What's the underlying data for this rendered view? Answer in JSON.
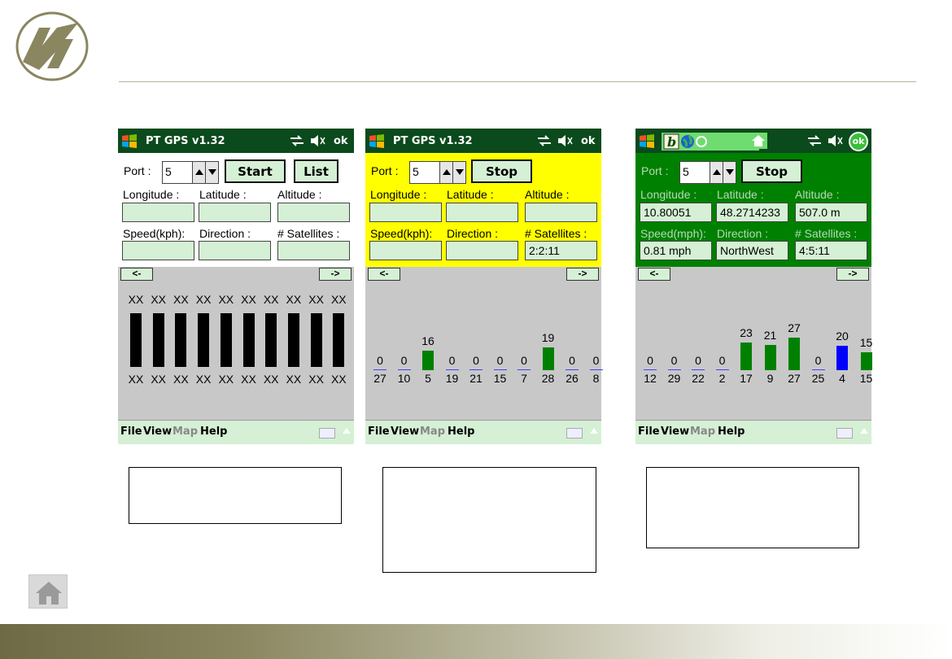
{
  "colors": {
    "accent_green": "#008000",
    "title_green": "#0b4a1c",
    "field_green": "#d5f0d5",
    "yellow": "#ffff00",
    "blue_bar": "#0000ff"
  },
  "logo": {
    "icon": "company-logo-icon"
  },
  "home": {
    "icon": "home-icon"
  },
  "screens": [
    {
      "title": "PT GPS v1.32",
      "ok": "ok",
      "port_label": "Port :",
      "port_value": "5",
      "btn1": "Start",
      "btn2": "List",
      "lon_label": "Longitude :",
      "lat_label": "Latitude :",
      "alt_label": "Altitude :",
      "speed_label": "Speed(kph):",
      "dir_label": "Direction :",
      "sat_label": "# Satellites :",
      "lon": "",
      "lat": "",
      "alt": "",
      "speed": "",
      "dir": "",
      "sat": "",
      "nav_left": "<-",
      "nav_right": "->",
      "menu": {
        "file": "File",
        "view": "View",
        "map": "Map",
        "help": "Help"
      },
      "bars_top": [
        "XX",
        "XX",
        "XX",
        "XX",
        "XX",
        "XX",
        "XX",
        "XX",
        "XX",
        "XX"
      ],
      "bars_bottom": [
        "XX",
        "XX",
        "XX",
        "XX",
        "XX",
        "XX",
        "XX",
        "XX",
        "XX",
        "XX"
      ]
    },
    {
      "title": "PT GPS v1.32",
      "ok": "ok",
      "port_label": "Port :",
      "port_value": "5",
      "btn1": "Stop",
      "lon_label": "Longitude :",
      "lat_label": "Latitude :",
      "alt_label": "Altitude :",
      "speed_label": "Speed(kph):",
      "dir_label": "Direction :",
      "sat_label": "# Satellites :",
      "lon": "",
      "lat": "",
      "alt": "",
      "speed": "",
      "dir": "",
      "sat": "2:2:11",
      "nav_left": "<-",
      "nav_right": "->",
      "menu": {
        "file": "File",
        "view": "View",
        "map": "Map",
        "help": "Help"
      },
      "snr": [
        "0",
        "0",
        "16",
        "0",
        "0",
        "0",
        "0",
        "19",
        "0",
        "0"
      ],
      "prn": [
        "27",
        "10",
        "5",
        "19",
        "21",
        "15",
        "7",
        "28",
        "26",
        "8"
      ]
    },
    {
      "ok": "ok",
      "port_label": "Port :",
      "port_value": "5",
      "btn1": "Stop",
      "lon_label": "Longitude :",
      "lat_label": "Latitude :",
      "alt_label": "Altitude :",
      "speed_label": "Speed(mph):",
      "dir_label": "Direction :",
      "sat_label": "# Satellites :",
      "lon": "10.80051",
      "lat": "48.2714233",
      "alt": "507.0 m",
      "speed": "0.81 mph",
      "dir": "NorthWest",
      "sat": "4:5:11",
      "nav_left": "<-",
      "nav_right": "->",
      "menu": {
        "file": "File",
        "view": "View",
        "map": "Map",
        "help": "Help"
      },
      "snr": [
        "0",
        "0",
        "0",
        "0",
        "23",
        "21",
        "27",
        "0",
        "20",
        "15"
      ],
      "prn": [
        "12",
        "29",
        "22",
        "2",
        "17",
        "9",
        "27",
        "25",
        "4",
        "15"
      ]
    }
  ]
}
